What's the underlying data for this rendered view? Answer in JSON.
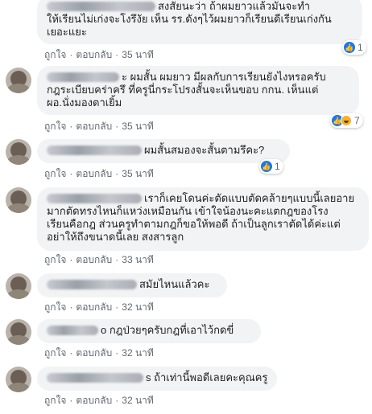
{
  "colors": {
    "bubble_bg": "#f2f3f5",
    "meta_text": "#606770",
    "like_blue": "#1877f2",
    "haha_yellow": "#f7b125"
  },
  "actions": {
    "like": "ถูกใจ",
    "reply": "ตอบกลับ",
    "separator": "·"
  },
  "comments": [
    {
      "lines": [
        "สงสัยนะว่า ถ้าผมยาวแล้วมันจะทำ",
        "ให้เรียนไม่เก่งจะโงรึงัย เห็น รร.ดังๆไว้ผมยาวก็เรียนดีเรียนเก่งกัน",
        "เยอะแยะ"
      ],
      "time": "35 นาที",
      "reaction_icons": [
        "like-icon"
      ],
      "reaction_count": "1"
    },
    {
      "lines": [
        "ะ ผมสั้น ผมยาว มีผลกับการเรียนยังไงหรอครับ",
        "กฎระเบียบคร่าครึ ที่ครูนี่กระโปรงสั้นจะเห็นขอบ กกน. เห็นแต่",
        "ผอ.นั่งมองตาเยิ้ม"
      ],
      "time": "35 นาที",
      "reaction_icons": [
        "like-icon",
        "haha-icon"
      ],
      "reaction_count": "7"
    },
    {
      "lines": [
        "ผมสั้นสมองจะสั้นตามรึคะ?"
      ],
      "time": "35 นาที",
      "reaction_icons": [
        "like-icon"
      ],
      "reaction_count": "1"
    },
    {
      "lines": [
        "เราก็เคยโดนค่ะตัดแบบตัดคล้ายๆแบบนี้เลยอาย",
        "มากตัดทรงไหนก็แหว่งเหมือนกัน เข้าใจน้องนะคะแตกฎของโรง",
        "เรียนคือกฎ ส่วนครูทำตามกฎก็ขอให้พอดี ถ้าเป็นลูกเราตัดได้ค่ะแต่",
        "อย่าให้ถึงขนาดนี้เลย สงสารลูก"
      ],
      "time": "33 นาที",
      "reaction_icons": [],
      "reaction_count": ""
    },
    {
      "lines": [
        "สมัยไหนแล้วคะ"
      ],
      "time": "32 นาที",
      "reaction_icons": [],
      "reaction_count": ""
    },
    {
      "lines": [
        "o กฎป่วยๆครับกฎที่เอาไว้กดขี่"
      ],
      "time": "32 นาที",
      "reaction_icons": [],
      "reaction_count": ""
    },
    {
      "lines": [
        "s ถ้าเท่านี้พอดีเลยคะคุณครู"
      ],
      "time": "32 นาที",
      "reaction_icons": [],
      "reaction_count": ""
    }
  ]
}
